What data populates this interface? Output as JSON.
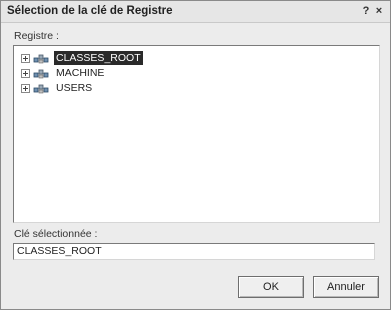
{
  "window": {
    "title": "Sélection de la clé de Registre",
    "help_glyph": "?",
    "close_glyph": "×"
  },
  "registry": {
    "label": "Registre :",
    "items": [
      {
        "label": "CLASSES_ROOT",
        "selected": true,
        "icon": "registry-node-icon"
      },
      {
        "label": "MACHINE",
        "selected": false,
        "icon": "registry-node-icon"
      },
      {
        "label": "USERS",
        "selected": false,
        "icon": "registry-node-icon"
      }
    ]
  },
  "selected_key": {
    "label": "Clé sélectionnée :",
    "value": "CLASSES_ROOT"
  },
  "buttons": {
    "ok": "OK",
    "cancel": "Annuler"
  }
}
